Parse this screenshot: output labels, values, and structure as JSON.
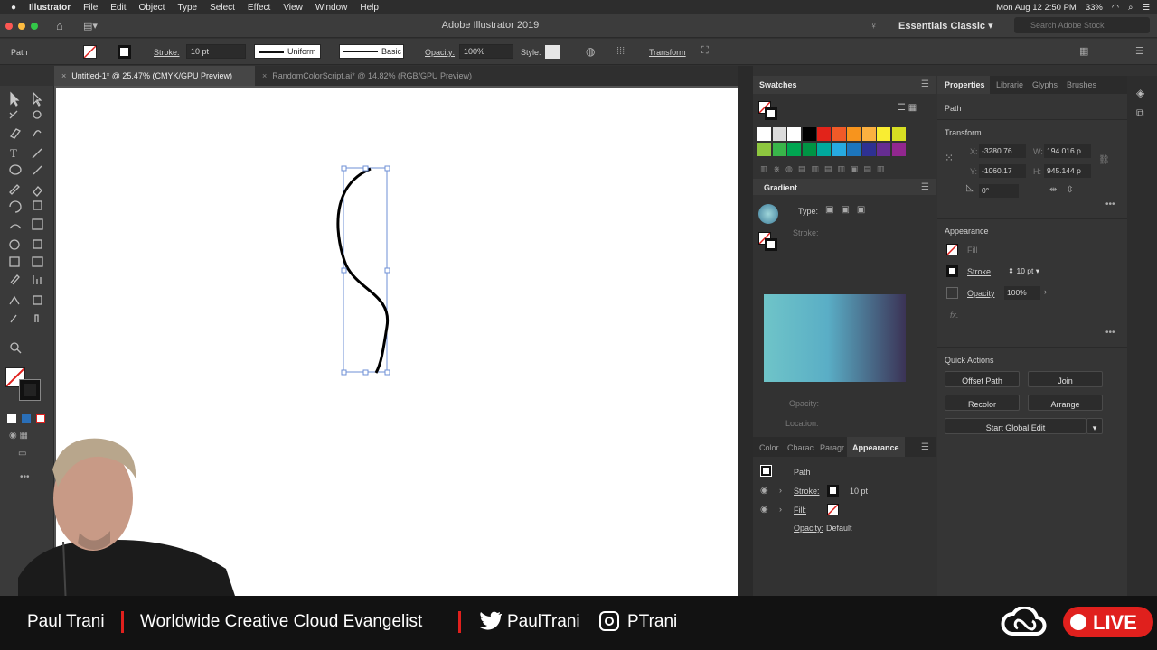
{
  "menubar": {
    "app": "Illustrator",
    "items": [
      "File",
      "Edit",
      "Object",
      "Type",
      "Select",
      "Effect",
      "View",
      "Window",
      "Help"
    ],
    "clock": "Mon Aug 12  2:50 PM",
    "battery": "33%"
  },
  "titlebar": {
    "title": "Adobe Illustrator 2019",
    "workspace": "Essentials Classic",
    "search_placeholder": "Search Adobe Stock"
  },
  "control": {
    "object": "Path",
    "stroke_label": "Stroke:",
    "stroke_value": "10 pt",
    "profile": "Uniform",
    "brush": "Basic",
    "opacity_label": "Opacity:",
    "opacity_value": "100%",
    "style_label": "Style:",
    "transform": "Transform"
  },
  "tabs": [
    {
      "label": "Untitled-1* @ 25.47% (CMYK/GPU Preview)"
    },
    {
      "label": "RandomColorScript.ai* @ 14.82% (RGB/GPU Preview)"
    }
  ],
  "swatches": {
    "title": "Swatches",
    "colors": [
      "#ffffff",
      "#000000",
      "#e2231a",
      "#f05a28",
      "#f7941d",
      "#fbb040",
      "#f9ed32",
      "#d7df23",
      "#8dc63f",
      "#39b54a",
      "#00a651",
      "#009444",
      "#00a99d",
      "#27aae1",
      "#1c75bc",
      "#2e3192",
      "#662d91",
      "#92278f"
    ]
  },
  "gradient": {
    "title": "Gradient",
    "type_label": "Type:",
    "stroke_label": "Stroke:",
    "opacity_label": "Opacity:",
    "location_label": "Location:"
  },
  "appearance_panel": {
    "tabs": [
      "Color",
      "Charac",
      "Paragr",
      "Appearance"
    ],
    "object": "Path",
    "stroke_label": "Stroke:",
    "stroke_value": "10 pt",
    "fill_label": "Fill:",
    "opacity_label": "Opacity:",
    "opacity_value": "Default"
  },
  "properties": {
    "tabs": [
      "Properties",
      "Librarie",
      "Glyphs",
      "Brushes"
    ],
    "object": "Path",
    "transform_title": "Transform",
    "x_label": "X:",
    "x": "-3280.76",
    "y_label": "Y:",
    "y": "-1060.17",
    "w_label": "W:",
    "w": "194.016 p",
    "h_label": "H:",
    "h": "945.144 p",
    "angle": "0°",
    "appearance_title": "Appearance",
    "fill": "Fill",
    "stroke": "Stroke",
    "stroke_value": "10 pt",
    "opacity": "Opacity",
    "opacity_value": "100%",
    "fx": "fx.",
    "quick_actions_title": "Quick Actions",
    "buttons": [
      "Offset Path",
      "Join",
      "Recolor",
      "Arrange",
      "Start Global Edit"
    ]
  },
  "lower_third": {
    "name": "Paul Trani",
    "role": "Worldwide Creative Cloud Evangelist",
    "twitter": "PaulTrani",
    "instagram": "PTrani",
    "live": "LIVE"
  },
  "colors": {
    "accent_red": "#e0201d",
    "gradient_start": "#6fc4c8",
    "gradient_end": "#3b3356"
  }
}
